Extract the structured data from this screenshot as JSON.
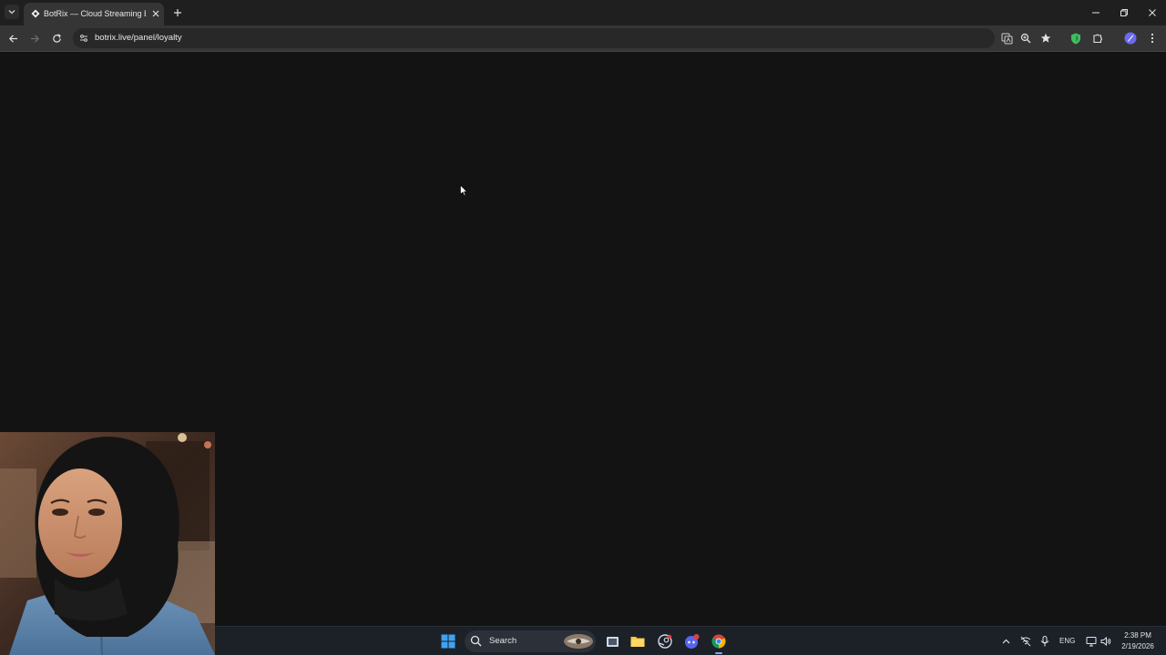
{
  "browser": {
    "tab": {
      "title": "BotRix — Cloud Streaming Bot",
      "favicon": "botrix-favicon-icon"
    },
    "address_bar": {
      "url": "botrix.live/panel/loyalty"
    },
    "toolbar_icons": [
      "back-icon",
      "forward-icon",
      "reload-icon",
      "site-info-icon",
      "translate-icon",
      "zoom-icon",
      "bookmark-star-icon",
      "extension-shield-icon",
      "extensions-puzzle-icon",
      "profile-icon",
      "menu-kebab-icon"
    ],
    "window_controls": [
      "minimize-icon",
      "restore-icon",
      "close-icon"
    ]
  },
  "page": {
    "background": "#131313"
  },
  "taskbar": {
    "search_label": "Search",
    "language": "ENG",
    "time": "2:38 PM",
    "date": "2/19/2026",
    "apps": [
      "windows-start-icon",
      "search-icon",
      "task-view-icon",
      "file-explorer-icon",
      "steam-icon",
      "discord-icon",
      "chrome-icon"
    ],
    "tray": [
      "chevron-up-icon",
      "network-icon",
      "microphone-icon",
      "display-icon",
      "volume-icon"
    ]
  },
  "colors": {
    "tab_strip": "#1f1f1f",
    "toolbar": "#353535",
    "omnibox": "#282828",
    "taskbar": "#1c2128",
    "accent_shield": "#3fbf5f",
    "profile": "#6b6bf0"
  }
}
